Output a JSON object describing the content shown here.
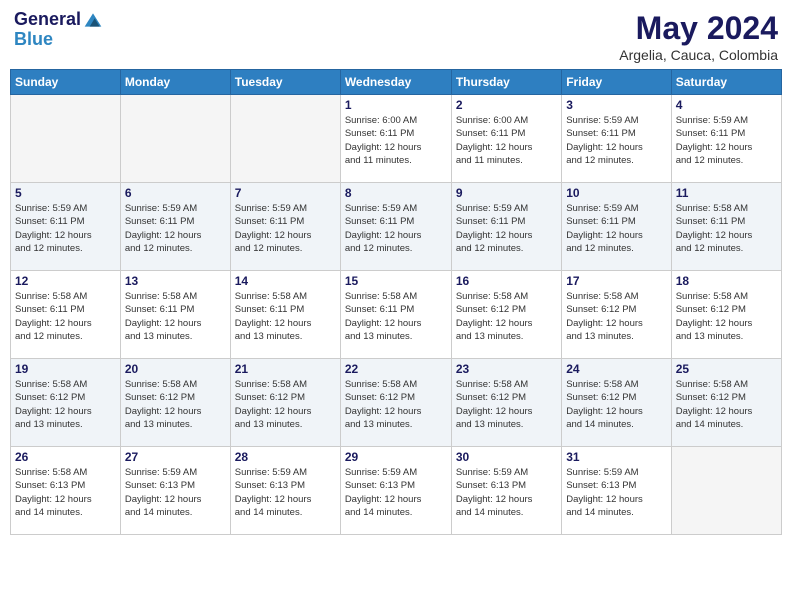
{
  "header": {
    "logo_line1": "General",
    "logo_line2": "Blue",
    "month_year": "May 2024",
    "location": "Argelia, Cauca, Colombia"
  },
  "columns": [
    "Sunday",
    "Monday",
    "Tuesday",
    "Wednesday",
    "Thursday",
    "Friday",
    "Saturday"
  ],
  "weeks": [
    [
      {
        "day": "",
        "info": ""
      },
      {
        "day": "",
        "info": ""
      },
      {
        "day": "",
        "info": ""
      },
      {
        "day": "1",
        "info": "Sunrise: 6:00 AM\nSunset: 6:11 PM\nDaylight: 12 hours\nand 11 minutes."
      },
      {
        "day": "2",
        "info": "Sunrise: 6:00 AM\nSunset: 6:11 PM\nDaylight: 12 hours\nand 11 minutes."
      },
      {
        "day": "3",
        "info": "Sunrise: 5:59 AM\nSunset: 6:11 PM\nDaylight: 12 hours\nand 12 minutes."
      },
      {
        "day": "4",
        "info": "Sunrise: 5:59 AM\nSunset: 6:11 PM\nDaylight: 12 hours\nand 12 minutes."
      }
    ],
    [
      {
        "day": "5",
        "info": "Sunrise: 5:59 AM\nSunset: 6:11 PM\nDaylight: 12 hours\nand 12 minutes."
      },
      {
        "day": "6",
        "info": "Sunrise: 5:59 AM\nSunset: 6:11 PM\nDaylight: 12 hours\nand 12 minutes."
      },
      {
        "day": "7",
        "info": "Sunrise: 5:59 AM\nSunset: 6:11 PM\nDaylight: 12 hours\nand 12 minutes."
      },
      {
        "day": "8",
        "info": "Sunrise: 5:59 AM\nSunset: 6:11 PM\nDaylight: 12 hours\nand 12 minutes."
      },
      {
        "day": "9",
        "info": "Sunrise: 5:59 AM\nSunset: 6:11 PM\nDaylight: 12 hours\nand 12 minutes."
      },
      {
        "day": "10",
        "info": "Sunrise: 5:59 AM\nSunset: 6:11 PM\nDaylight: 12 hours\nand 12 minutes."
      },
      {
        "day": "11",
        "info": "Sunrise: 5:58 AM\nSunset: 6:11 PM\nDaylight: 12 hours\nand 12 minutes."
      }
    ],
    [
      {
        "day": "12",
        "info": "Sunrise: 5:58 AM\nSunset: 6:11 PM\nDaylight: 12 hours\nand 12 minutes."
      },
      {
        "day": "13",
        "info": "Sunrise: 5:58 AM\nSunset: 6:11 PM\nDaylight: 12 hours\nand 13 minutes."
      },
      {
        "day": "14",
        "info": "Sunrise: 5:58 AM\nSunset: 6:11 PM\nDaylight: 12 hours\nand 13 minutes."
      },
      {
        "day": "15",
        "info": "Sunrise: 5:58 AM\nSunset: 6:11 PM\nDaylight: 12 hours\nand 13 minutes."
      },
      {
        "day": "16",
        "info": "Sunrise: 5:58 AM\nSunset: 6:12 PM\nDaylight: 12 hours\nand 13 minutes."
      },
      {
        "day": "17",
        "info": "Sunrise: 5:58 AM\nSunset: 6:12 PM\nDaylight: 12 hours\nand 13 minutes."
      },
      {
        "day": "18",
        "info": "Sunrise: 5:58 AM\nSunset: 6:12 PM\nDaylight: 12 hours\nand 13 minutes."
      }
    ],
    [
      {
        "day": "19",
        "info": "Sunrise: 5:58 AM\nSunset: 6:12 PM\nDaylight: 12 hours\nand 13 minutes."
      },
      {
        "day": "20",
        "info": "Sunrise: 5:58 AM\nSunset: 6:12 PM\nDaylight: 12 hours\nand 13 minutes."
      },
      {
        "day": "21",
        "info": "Sunrise: 5:58 AM\nSunset: 6:12 PM\nDaylight: 12 hours\nand 13 minutes."
      },
      {
        "day": "22",
        "info": "Sunrise: 5:58 AM\nSunset: 6:12 PM\nDaylight: 12 hours\nand 13 minutes."
      },
      {
        "day": "23",
        "info": "Sunrise: 5:58 AM\nSunset: 6:12 PM\nDaylight: 12 hours\nand 13 minutes."
      },
      {
        "day": "24",
        "info": "Sunrise: 5:58 AM\nSunset: 6:12 PM\nDaylight: 12 hours\nand 14 minutes."
      },
      {
        "day": "25",
        "info": "Sunrise: 5:58 AM\nSunset: 6:12 PM\nDaylight: 12 hours\nand 14 minutes."
      }
    ],
    [
      {
        "day": "26",
        "info": "Sunrise: 5:58 AM\nSunset: 6:13 PM\nDaylight: 12 hours\nand 14 minutes."
      },
      {
        "day": "27",
        "info": "Sunrise: 5:59 AM\nSunset: 6:13 PM\nDaylight: 12 hours\nand 14 minutes."
      },
      {
        "day": "28",
        "info": "Sunrise: 5:59 AM\nSunset: 6:13 PM\nDaylight: 12 hours\nand 14 minutes."
      },
      {
        "day": "29",
        "info": "Sunrise: 5:59 AM\nSunset: 6:13 PM\nDaylight: 12 hours\nand 14 minutes."
      },
      {
        "day": "30",
        "info": "Sunrise: 5:59 AM\nSunset: 6:13 PM\nDaylight: 12 hours\nand 14 minutes."
      },
      {
        "day": "31",
        "info": "Sunrise: 5:59 AM\nSunset: 6:13 PM\nDaylight: 12 hours\nand 14 minutes."
      },
      {
        "day": "",
        "info": ""
      }
    ]
  ]
}
